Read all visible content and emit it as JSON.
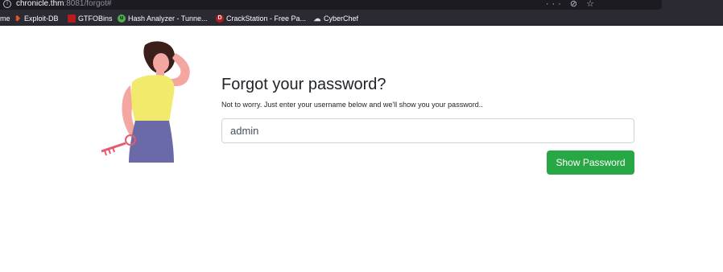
{
  "browser": {
    "url_host": "chronicle.thm",
    "url_rest": ":8081/forgot#",
    "url_actions": "··· ⊘ ☆"
  },
  "bookmarks": [
    {
      "label": "me",
      "icon": "none"
    },
    {
      "label": "Exploit-DB",
      "icon": "exploit-db-icon",
      "color": "#e8542a"
    },
    {
      "label": "GTFOBins",
      "icon": "gtfobins-icon",
      "color": "#b71c1c"
    },
    {
      "label": "Hash Analyzer - Tunne...",
      "icon": "hash-analyzer-icon",
      "color": "#4caf50"
    },
    {
      "label": "CrackStation - Free Pa...",
      "icon": "crackstation-icon",
      "color": "#b71c1c"
    },
    {
      "label": "CyberChef",
      "icon": "cyberchef-icon",
      "color": "#dddddd"
    }
  ],
  "form": {
    "title": "Forgot your password?",
    "subtitle": "Not to worry. Just enter your username below and we'll show you your password..",
    "username_value": "admin",
    "button_label": "Show Password"
  },
  "colors": {
    "button": "#28a745",
    "browser_chrome": "#2b2a33"
  }
}
